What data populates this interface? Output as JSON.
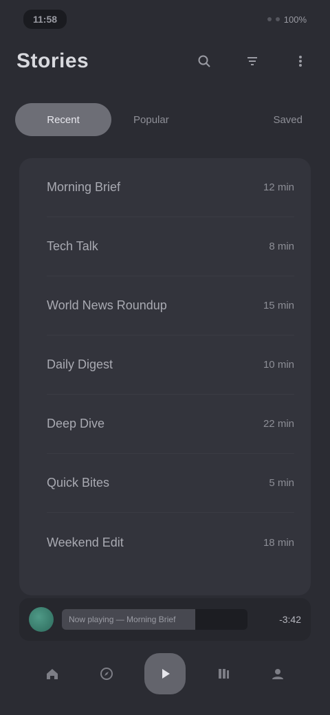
{
  "status_bar": {
    "time": "11:58",
    "right_text": "100%"
  },
  "header": {
    "title": "Stories",
    "actions": [
      {
        "icon": "search-icon"
      },
      {
        "icon": "filter-icon"
      },
      {
        "icon": "more-icon"
      }
    ]
  },
  "filters": {
    "active": "Recent",
    "others": [
      "Popular",
      "Saved"
    ]
  },
  "list": {
    "items": [
      {
        "name": "Morning Brief",
        "value": "12 min"
      },
      {
        "name": "Tech Talk",
        "value": "8 min"
      },
      {
        "name": "World News Roundup",
        "value": "15 min"
      },
      {
        "name": "Daily Digest",
        "value": "10 min"
      },
      {
        "name": "Deep Dive",
        "value": "22 min"
      },
      {
        "name": "Quick Bites",
        "value": "5 min"
      },
      {
        "name": "Weekend Edit",
        "value": "18 min"
      }
    ]
  },
  "player": {
    "title": "Now playing — Morning Brief",
    "time": "-3:42",
    "progress": 0.72
  },
  "bottom_nav": {
    "items": [
      {
        "icon": "home-icon",
        "label": "Home"
      },
      {
        "icon": "explore-icon",
        "label": "Explore"
      },
      {
        "icon": "play-icon",
        "label": "Play"
      },
      {
        "icon": "library-icon",
        "label": "Library"
      },
      {
        "icon": "profile-icon",
        "label": "Profile"
      }
    ]
  },
  "colors": {
    "background": "#2b2c33",
    "card": "#33343c",
    "accent": "#4f9a87"
  }
}
